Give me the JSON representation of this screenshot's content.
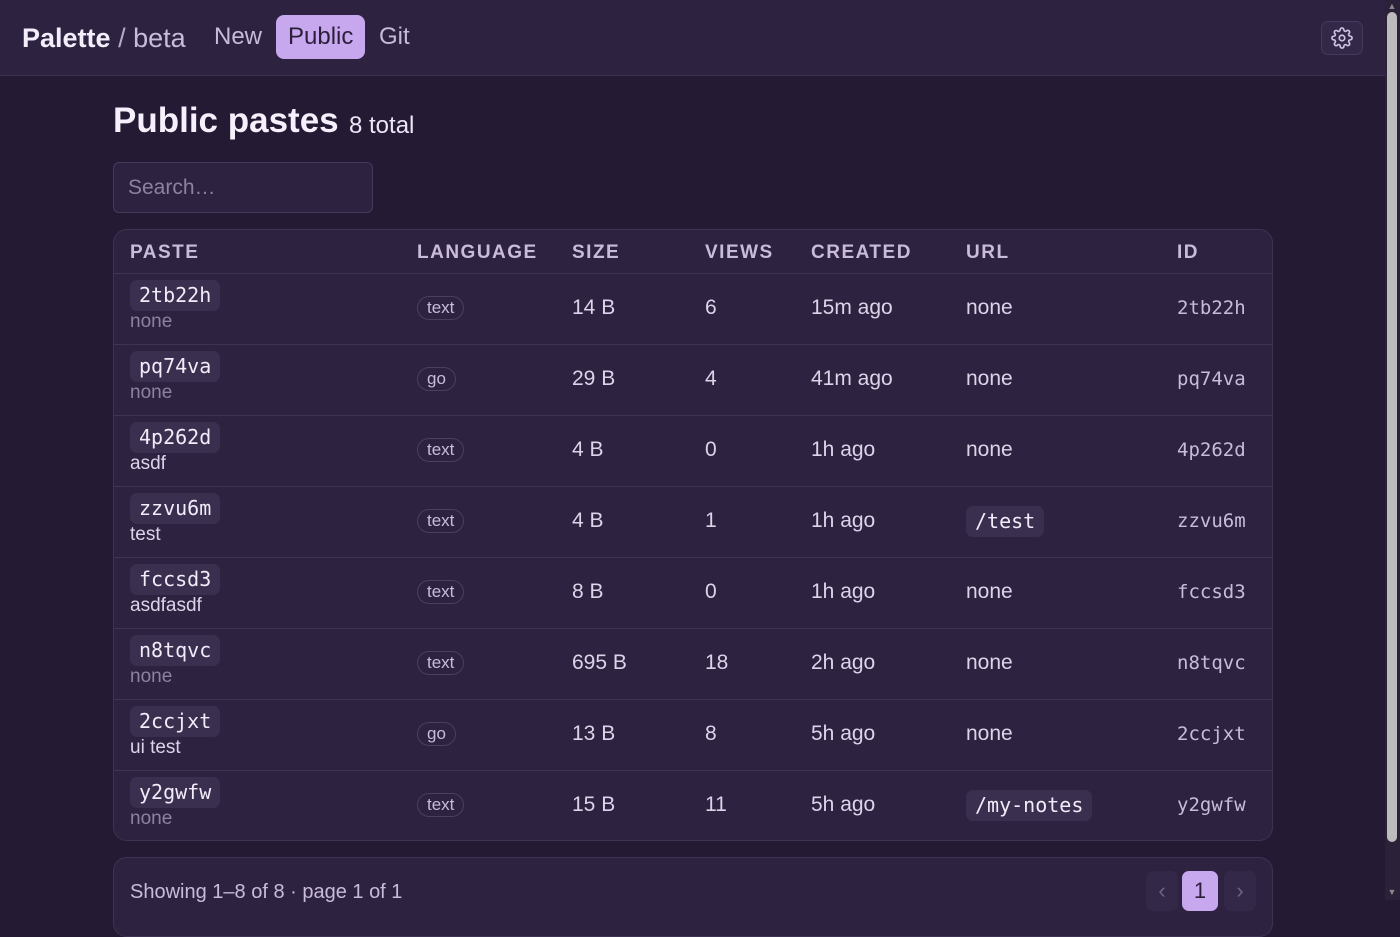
{
  "header": {
    "brand_name": "Palette",
    "brand_sep": "/",
    "brand_sub": "beta",
    "nav": [
      "New",
      "Public",
      "Git"
    ],
    "active_nav": "Public",
    "settings_icon": "gear-icon"
  },
  "page": {
    "title": "Public pastes",
    "count": "8 total",
    "search_placeholder": "Search…"
  },
  "table": {
    "columns": [
      "PASTE",
      "LANGUAGE",
      "SIZE",
      "VIEWS",
      "CREATED",
      "URL",
      "ID"
    ],
    "rows": [
      {
        "slug": "2tb22h",
        "title": "none",
        "title_muted": true,
        "lang": "text",
        "size": "14 B",
        "views": "6",
        "created": "15m ago",
        "url": "none",
        "url_is_path": false,
        "id": "2tb22h"
      },
      {
        "slug": "pq74va",
        "title": "none",
        "title_muted": true,
        "lang": "go",
        "size": "29 B",
        "views": "4",
        "created": "41m ago",
        "url": "none",
        "url_is_path": false,
        "id": "pq74va"
      },
      {
        "slug": "4p262d",
        "title": "asdf",
        "title_muted": false,
        "lang": "text",
        "size": "4 B",
        "views": "0",
        "created": "1h ago",
        "url": "none",
        "url_is_path": false,
        "id": "4p262d"
      },
      {
        "slug": "zzvu6m",
        "title": "test",
        "title_muted": false,
        "lang": "text",
        "size": "4 B",
        "views": "1",
        "created": "1h ago",
        "url": "/test",
        "url_is_path": true,
        "id": "zzvu6m"
      },
      {
        "slug": "fccsd3",
        "title": "asdfasdf",
        "title_muted": false,
        "lang": "text",
        "size": "8 B",
        "views": "0",
        "created": "1h ago",
        "url": "none",
        "url_is_path": false,
        "id": "fccsd3"
      },
      {
        "slug": "n8tqvc",
        "title": "none",
        "title_muted": true,
        "lang": "text",
        "size": "695 B",
        "views": "18",
        "created": "2h ago",
        "url": "none",
        "url_is_path": false,
        "id": "n8tqvc"
      },
      {
        "slug": "2ccjxt",
        "title": "ui test",
        "title_muted": false,
        "lang": "go",
        "size": "13 B",
        "views": "8",
        "created": "5h ago",
        "url": "none",
        "url_is_path": false,
        "id": "2ccjxt"
      },
      {
        "slug": "y2gwfw",
        "title": "none",
        "title_muted": true,
        "lang": "text",
        "size": "15 B",
        "views": "11",
        "created": "5h ago",
        "url": "/my-notes",
        "url_is_path": true,
        "id": "y2gwfw"
      }
    ]
  },
  "footer": {
    "summary": "Showing 1–8 of 8 · page 1 of 1",
    "prev_label": "‹",
    "current_page": "1",
    "next_label": "›"
  },
  "colors": {
    "background": "#241a33",
    "surface": "#2d2240",
    "accent": "#c7a7ee"
  }
}
